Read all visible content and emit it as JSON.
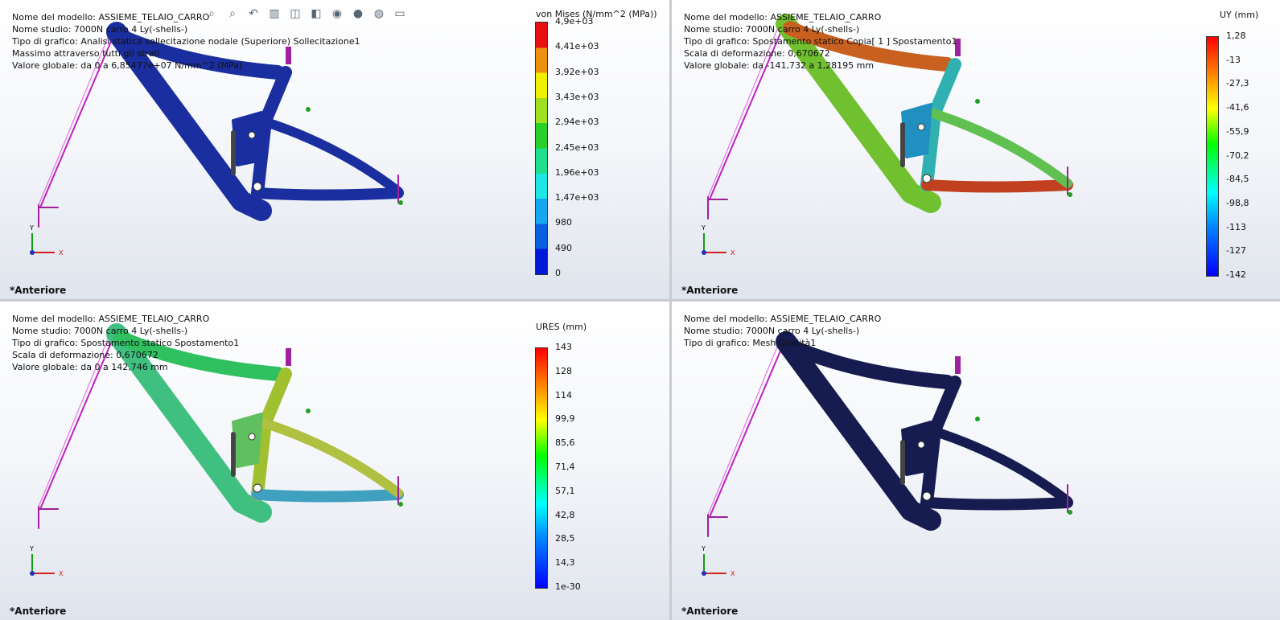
{
  "panels": [
    {
      "model": "Nome del modello: ASSIEME_TELAIO_CARRO",
      "study": "Nome studio: 7000N carro 4 Ly(-shells-)",
      "plot": "Tipo di grafico: Analisi statica sollecitazione nodale (Superiore) Sollecitazione1",
      "extra": "Massimo attraverso tutti gli strati",
      "global": "Valore globale: da 0 a 6,85477e+07 N/mm^2 (MPa)",
      "view": "*Anteriore",
      "legend_title": "von Mises (N/mm^2 (MPa))",
      "ticks": [
        "4,9e+03",
        "4,41e+03",
        "3,92e+03",
        "3,43e+03",
        "2,94e+03",
        "2,45e+03",
        "1,96e+03",
        "1,47e+03",
        "980",
        "490",
        "0"
      ]
    },
    {
      "model": "Nome del modello: ASSIEME_TELAIO_CARRO",
      "study": "Nome studio: 7000N carro 4 Ly(-shells-)",
      "plot": "Tipo di grafico: Spostamento statico Copia[ 1 ] Spostamento1",
      "extra": "Scala di deformazione: 0,670672",
      "global": "Valore globale: da -141,732 a 1,28195 mm",
      "view": "*Anteriore",
      "legend_title": "UY (mm)",
      "ticks": [
        "1,28",
        "-13",
        "-27,3",
        "-41,6",
        "-55,9",
        "-70,2",
        "-84,5",
        "-98,8",
        "-113",
        "-127",
        "-142"
      ]
    },
    {
      "model": "Nome del modello: ASSIEME_TELAIO_CARRO",
      "study": "Nome studio: 7000N carro 4 Ly(-shells-)",
      "plot": "Tipo di grafico: Spostamento statico Spostamento1",
      "extra": "Scala di deformazione: 0,670672",
      "global": "Valore globale: da 0 a 142,746 mm",
      "view": "*Anteriore",
      "legend_title": "URES (mm)",
      "ticks": [
        "143",
        "128",
        "114",
        "99,9",
        "85,6",
        "71,4",
        "57,1",
        "42,8",
        "28,5",
        "14,3",
        "1e-30"
      ]
    },
    {
      "model": "Nome del modello: ASSIEME_TELAIO_CARRO",
      "study": "Nome studio: 7000N carro 4 Ly(-shells-)",
      "plot": "Tipo di grafico: Mesh Qualità1",
      "view": "*Anteriore"
    }
  ],
  "toolbar": [
    "zoom-to-fit",
    "zoom-area",
    "previous-view",
    "section-view",
    "view-orientation",
    "display-style",
    "hide-show",
    "edit-appearance",
    "scene",
    "display-manager"
  ],
  "axes": {
    "y": "Y",
    "x": "X"
  },
  "colors": {
    "von_mises_low": "#1a2a9c",
    "mesh": "#151a4a",
    "constraint": "#c020c0"
  }
}
